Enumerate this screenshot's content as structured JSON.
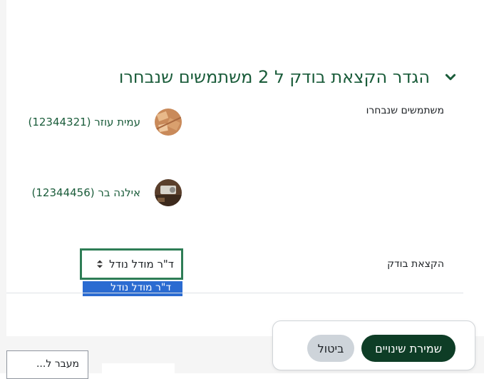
{
  "section": {
    "title": "הגדר הקצאת בודק ל 2 משתמשים שנבחרו",
    "chevron_icon": "chevron-down-icon"
  },
  "form": {
    "selected_users_label": "משתמשים שנבחרו",
    "marker_allocation_label": "הקצאת בודק"
  },
  "users": [
    {
      "name": "עמית עוזר (12344321)"
    },
    {
      "name": "אילנה בר (12344456)"
    }
  ],
  "marker_select": {
    "value": "ד\"ר מודל נודל",
    "options": [
      "ד\"ר מודל נודל"
    ]
  },
  "footer": {
    "save_label": "שמירת שינויים",
    "cancel_label": "ביטול"
  },
  "jump_to": {
    "placeholder": "מעבר ל..."
  },
  "colors": {
    "brand_green": "#1a5c3a",
    "save_button": "#0e3d26",
    "selection_blue": "#2b6bd1"
  }
}
